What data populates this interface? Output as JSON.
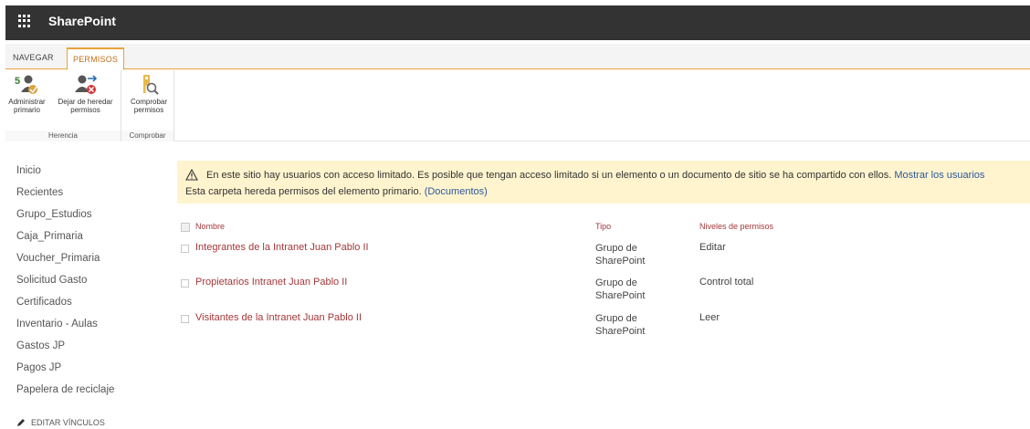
{
  "suitebar": {
    "brand": "SharePoint"
  },
  "ribbon": {
    "tabs": [
      {
        "label": "NAVEGAR"
      },
      {
        "label": "PERMISOS"
      }
    ],
    "groups": {
      "herencia": {
        "label": "Herencia",
        "buttons": [
          {
            "line1": "Administrar",
            "line2": "primario"
          },
          {
            "line1": "Dejar de heredar",
            "line2": "permisos"
          }
        ]
      },
      "comprobar": {
        "label": "Comprobar",
        "buttons": [
          {
            "line1": "Comprobar",
            "line2": "permisos"
          }
        ]
      }
    }
  },
  "leftnav": {
    "items": [
      "Inicio",
      "Recientes",
      "Grupo_Estudios",
      "Caja_Primaria",
      "Voucher_Primaria",
      "Solicitud Gasto",
      "Certificados",
      "Inventario - Aulas",
      "Gastos JP",
      "Pagos JP",
      "Papelera de reciclaje"
    ],
    "edit_links": "EDITAR VÍNCULOS"
  },
  "banner": {
    "line1": "En este sitio hay usuarios con acceso limitado. Es posible que tengan acceso limitado si un elemento o un documento de sitio se ha compartido con ellos.",
    "line1_link": "Mostrar los usuarios",
    "line2": "Esta carpeta hereda permisos del elemento primario.",
    "line2_link": "(Documentos)"
  },
  "table": {
    "headers": {
      "name": "Nombre",
      "type": "Tipo",
      "level": "Niveles de permisos"
    },
    "rows": [
      {
        "name": "Integrantes de la Intranet Juan Pablo II",
        "type": "Grupo de SharePoint",
        "level": "Editar"
      },
      {
        "name": "Propietarios Intranet Juan Pablo II",
        "type": "Grupo de SharePoint",
        "level": "Control total"
      },
      {
        "name": "Visitantes de la Intranet Juan Pablo II",
        "type": "Grupo de SharePoint",
        "level": "Leer"
      }
    ]
  },
  "colors": {
    "suitebar": "#333333",
    "accent_orange": "#e8a33c",
    "link_red": "#a4373a",
    "link_blue": "#2b579a",
    "banner_bg": "#fff4ce"
  },
  "icons": [
    "waffle-icon",
    "manage-parent-icon",
    "stop-inherit-icon",
    "check-permissions-icon",
    "warning-icon",
    "pencil-icon"
  ]
}
